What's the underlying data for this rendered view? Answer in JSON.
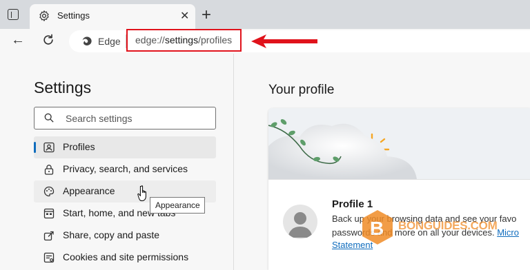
{
  "tab": {
    "title": "Settings"
  },
  "toolbar": {
    "browser_label": "Edge",
    "url_prefix": "edge://",
    "url_main": "settings",
    "url_suffix": "/profiles"
  },
  "sidebar": {
    "title": "Settings",
    "search_placeholder": "Search settings",
    "items": [
      {
        "label": "Profiles"
      },
      {
        "label": "Privacy, search, and services"
      },
      {
        "label": "Appearance"
      },
      {
        "label": "Start, home, and new tabs"
      },
      {
        "label": "Share, copy and paste"
      },
      {
        "label": "Cookies and site permissions"
      }
    ],
    "tooltip": "Appearance"
  },
  "main": {
    "heading": "Your profile",
    "profile_name": "Profile 1",
    "desc_line1": "Back up your browsing data and see your favo",
    "desc_line2": "passwords and more on all your devices. ",
    "desc_link": "Micro",
    "desc_line3": "Statement"
  },
  "watermark": "BONGUIDES.COM",
  "colors": {
    "accent": "#0f6cbd",
    "highlight": "#e0121b"
  }
}
